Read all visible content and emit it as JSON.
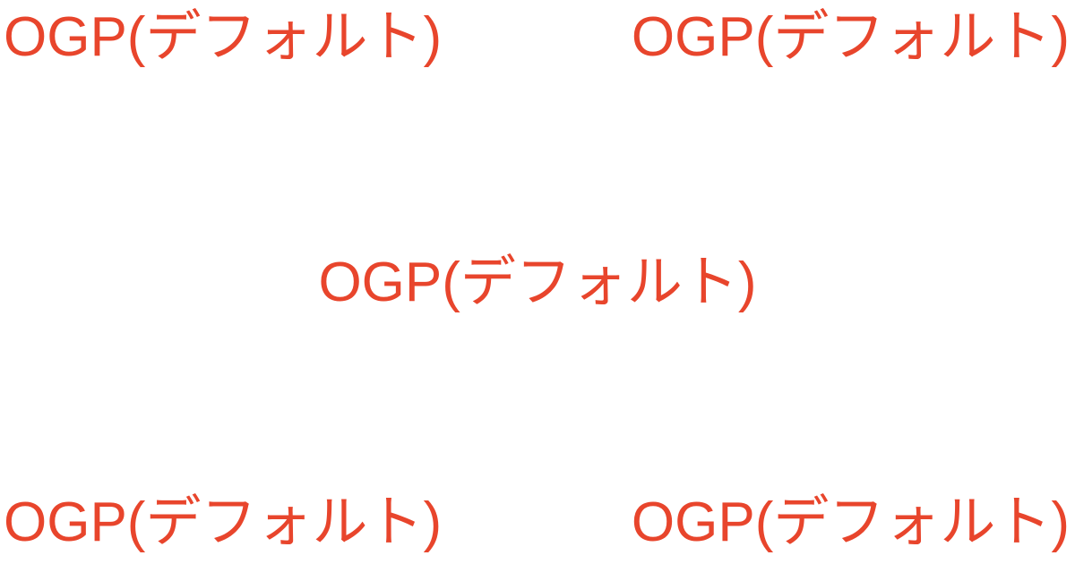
{
  "labels": {
    "top_left": "OGP(デフォルト)",
    "top_right": "OGP(デフォルト)",
    "center": "OGP(デフォルト)",
    "bottom_left": "OGP(デフォルト)",
    "bottom_right": "OGP(デフォルト)"
  },
  "colors": {
    "text": "#e8452c",
    "background": "#ffffff"
  }
}
